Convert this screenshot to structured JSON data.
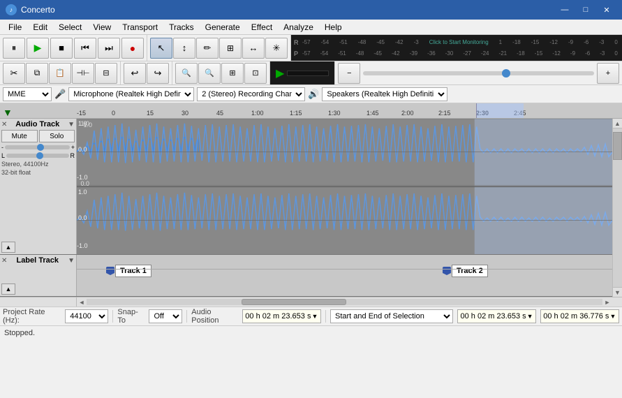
{
  "app": {
    "title": "Concerto",
    "icon": "♪"
  },
  "titlebar": {
    "minimize": "—",
    "maximize": "□",
    "close": "✕"
  },
  "menu": {
    "items": [
      "File",
      "Edit",
      "Select",
      "View",
      "Transport",
      "Tracks",
      "Generate",
      "Effect",
      "Analyze",
      "Help"
    ]
  },
  "transport": {
    "pause": "⏸",
    "play": "▶",
    "stop": "■",
    "prev": "⏮",
    "next": "⏭",
    "record": "●"
  },
  "tools": {
    "select": "↖",
    "envelope": "↕",
    "draw": "✏",
    "zoom": "🔍",
    "timeshift": "↔",
    "multitool": "✳"
  },
  "meters": {
    "record_label": "R",
    "playback_label": "P",
    "scale": [
      "-57",
      "-54",
      "-51",
      "-48",
      "-45",
      "-42",
      "-3",
      "Click to Start Monitoring",
      "1",
      "-18",
      "-15",
      "-12",
      "-9",
      "-6",
      "-3",
      "0"
    ],
    "scale2": [
      "-57",
      "-54",
      "-51",
      "-48",
      "-45",
      "-42",
      "-39",
      "-36",
      "-30",
      "-27",
      "-24",
      "-21",
      "-18",
      "-15",
      "-12",
      "-9",
      "-6",
      "-3",
      "0"
    ],
    "click_monitor": "Click to Start Monitoring"
  },
  "edit_toolbar": {
    "cut": "✂",
    "copy": "⧉",
    "paste": "📋",
    "trim": "⊣⊢",
    "undo": "↩",
    "redo": "↪",
    "zoom_out": "🔍-",
    "zoom_in": "🔍+",
    "zoom_fit_h": "⊡",
    "zoom_fit_v": "⊟"
  },
  "play_controls": {
    "play_green": "▶",
    "loop": "↺"
  },
  "device": {
    "host": "MME",
    "mic_icon": "🎤",
    "microphone": "Microphone (Realtek High Defini",
    "channels": "2 (Stereo) Recording Channels",
    "speaker_icon": "🔊",
    "speaker": "Speakers (Realtek High Definiti"
  },
  "timeline": {
    "arrow": "▼",
    "markers": [
      "-15",
      "0",
      "15",
      "30",
      "45",
      "1:00",
      "1:15",
      "1:30",
      "1:45",
      "2:00",
      "2:15",
      "2:30",
      "2:45"
    ]
  },
  "audio_track": {
    "close": "✕",
    "name": "Audio Track",
    "dropdown": "▼",
    "mute": "Mute",
    "solo": "Solo",
    "gain_minus": "-",
    "gain_plus": "+",
    "pan_l": "L",
    "pan_r": "R",
    "info": "Stereo, 44100Hz",
    "info2": "32-bit float",
    "scale_top": "1.0",
    "scale_mid": "0.0",
    "scale_bot": "-1.0",
    "collapse_btn": "▲"
  },
  "label_track": {
    "close": "✕",
    "name": "Label Track",
    "dropdown": "▼",
    "collapse_btn": "▲",
    "label1": "Track 1",
    "label2": "Track 2",
    "label1_pos": "150",
    "label2_pos": "632"
  },
  "status_bar": {
    "project_rate_label": "Project Rate (Hz):",
    "project_rate_value": "44100",
    "snap_to_label": "Snap-To",
    "snap_to_value": "Off",
    "audio_pos_label": "Audio Position",
    "selection_mode": "Start and End of Selection",
    "time1": "00 h 02 m 23.653 s",
    "time2": "00 h 02 m 23.653 s",
    "time3": "00 h 02 m 36.776 s"
  },
  "bottom_status": {
    "text": "Stopped."
  }
}
